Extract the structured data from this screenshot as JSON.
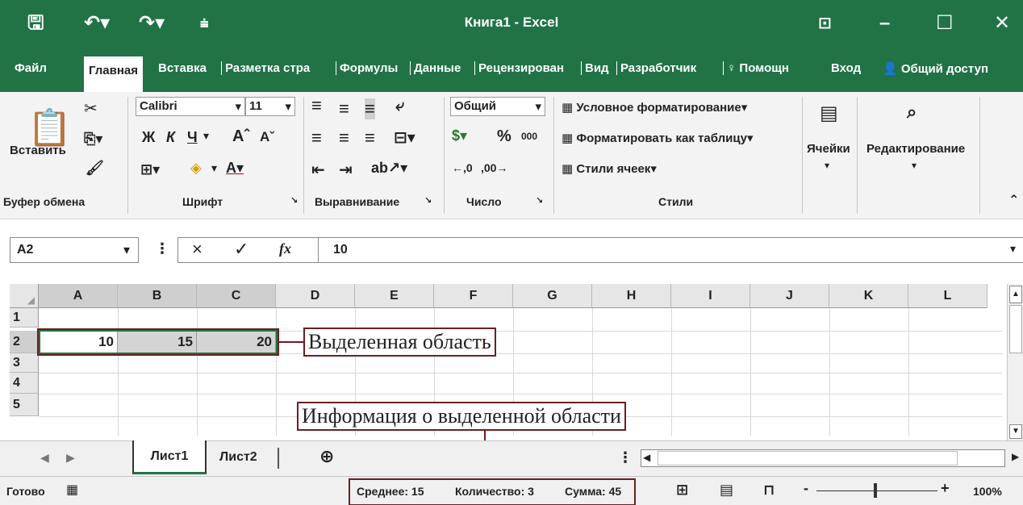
{
  "titlebar": {
    "title": "Книга1 - Excel",
    "save_icon": "save-icon",
    "undo_icon": "undo-icon",
    "redo_icon": "redo-icon"
  },
  "tabs": [
    "Файл",
    "Главная",
    "Вставка",
    "Разметка стра",
    "Формулы",
    "Данные",
    "Рецензирован",
    "Вид",
    "Разработчик",
    "Помощн",
    "Вход",
    "Общий доступ"
  ],
  "ribbon": {
    "paste": "Вставить",
    "clipboard": "Буфер обмена",
    "font_name": "Calibri",
    "font_size": "11",
    "bold": "Ж",
    "italic": "К",
    "underline": "Ч",
    "font_group": "Шрифт",
    "align_group": "Выравнивание",
    "number_format": "Общий",
    "percent": "%",
    "thousands": "000",
    "number_group": "Число",
    "cond_format": "Условное форматирование",
    "format_table": "Форматировать как таблицу",
    "cell_styles": "Стили ячеек",
    "styles_group": "Стили",
    "cells": "Ячейки",
    "editing": "Редактирование"
  },
  "formula_bar": {
    "name_box": "A2",
    "value": "10",
    "cancel": "×",
    "enter": "✓",
    "fx": "fx"
  },
  "columns": [
    "A",
    "B",
    "C",
    "D",
    "E",
    "F",
    "G",
    "H",
    "I",
    "J",
    "K",
    "L"
  ],
  "rows": [
    "1",
    "2",
    "3",
    "4",
    "5"
  ],
  "cells": {
    "A2": "10",
    "B2": "15",
    "C2": "20"
  },
  "callouts": {
    "selection": "Выделенная область",
    "info": "Информация о выделенной области"
  },
  "sheets": [
    "Лист1",
    "Лист2"
  ],
  "status": {
    "ready": "Готово",
    "average": "Среднее: 15",
    "count": "Количество: 3",
    "sum": "Сумма: 45",
    "zoom": "100%"
  },
  "colors": {
    "accent": "#217346",
    "callout_border": "#6b1f1f"
  }
}
